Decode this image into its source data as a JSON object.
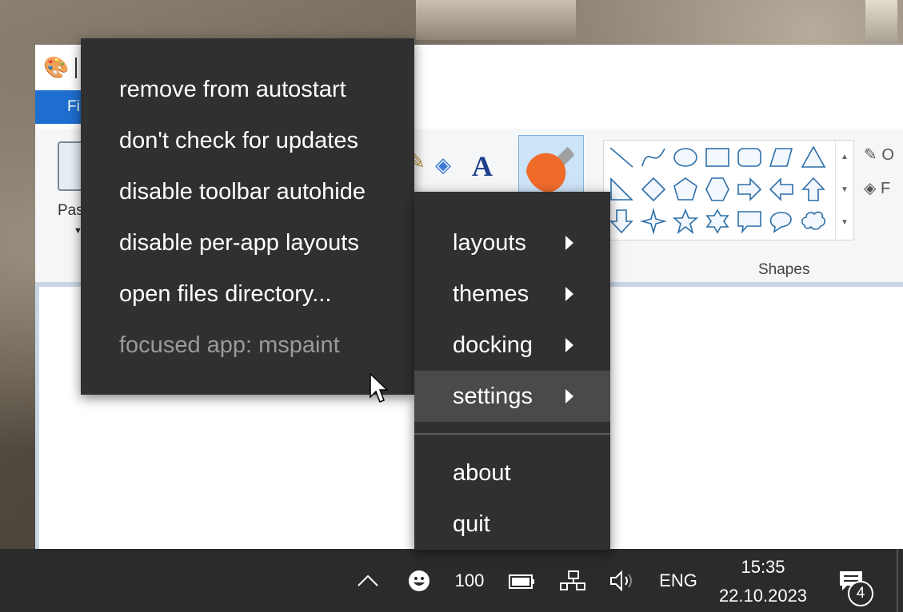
{
  "paint": {
    "file_tab_label": "Fi",
    "paste_label": "Pas",
    "shapes_label": "Shapes",
    "outline_label": "O",
    "fill_label": "F"
  },
  "settings_menu": {
    "items": [
      {
        "label": "remove from autostart",
        "enabled": true
      },
      {
        "label": "don't check for updates",
        "enabled": true
      },
      {
        "label": "disable toolbar autohide",
        "enabled": true
      },
      {
        "label": "disable per-app layouts",
        "enabled": true
      },
      {
        "label": "open files directory...",
        "enabled": true
      },
      {
        "label": "focused app: mspaint",
        "enabled": false
      }
    ]
  },
  "main_menu": {
    "items": [
      {
        "label": "layouts",
        "has_submenu": true
      },
      {
        "label": "themes",
        "has_submenu": true
      },
      {
        "label": "docking",
        "has_submenu": true
      },
      {
        "label": "settings",
        "has_submenu": true,
        "highlighted": true
      }
    ],
    "footer_items": [
      {
        "label": "about"
      },
      {
        "label": "quit"
      }
    ]
  },
  "taskbar": {
    "battery_percent": "100",
    "language": "ENG",
    "time": "15:35",
    "date": "22.10.2023",
    "notification_count": "4"
  },
  "colors": {
    "menu_bg": "#303030",
    "menu_highlight": "#4a4a4a",
    "taskbar_bg": "#2b2b2b",
    "paint_file_tab": "#1e6fd0",
    "shape_stroke": "#2d6ea8"
  }
}
